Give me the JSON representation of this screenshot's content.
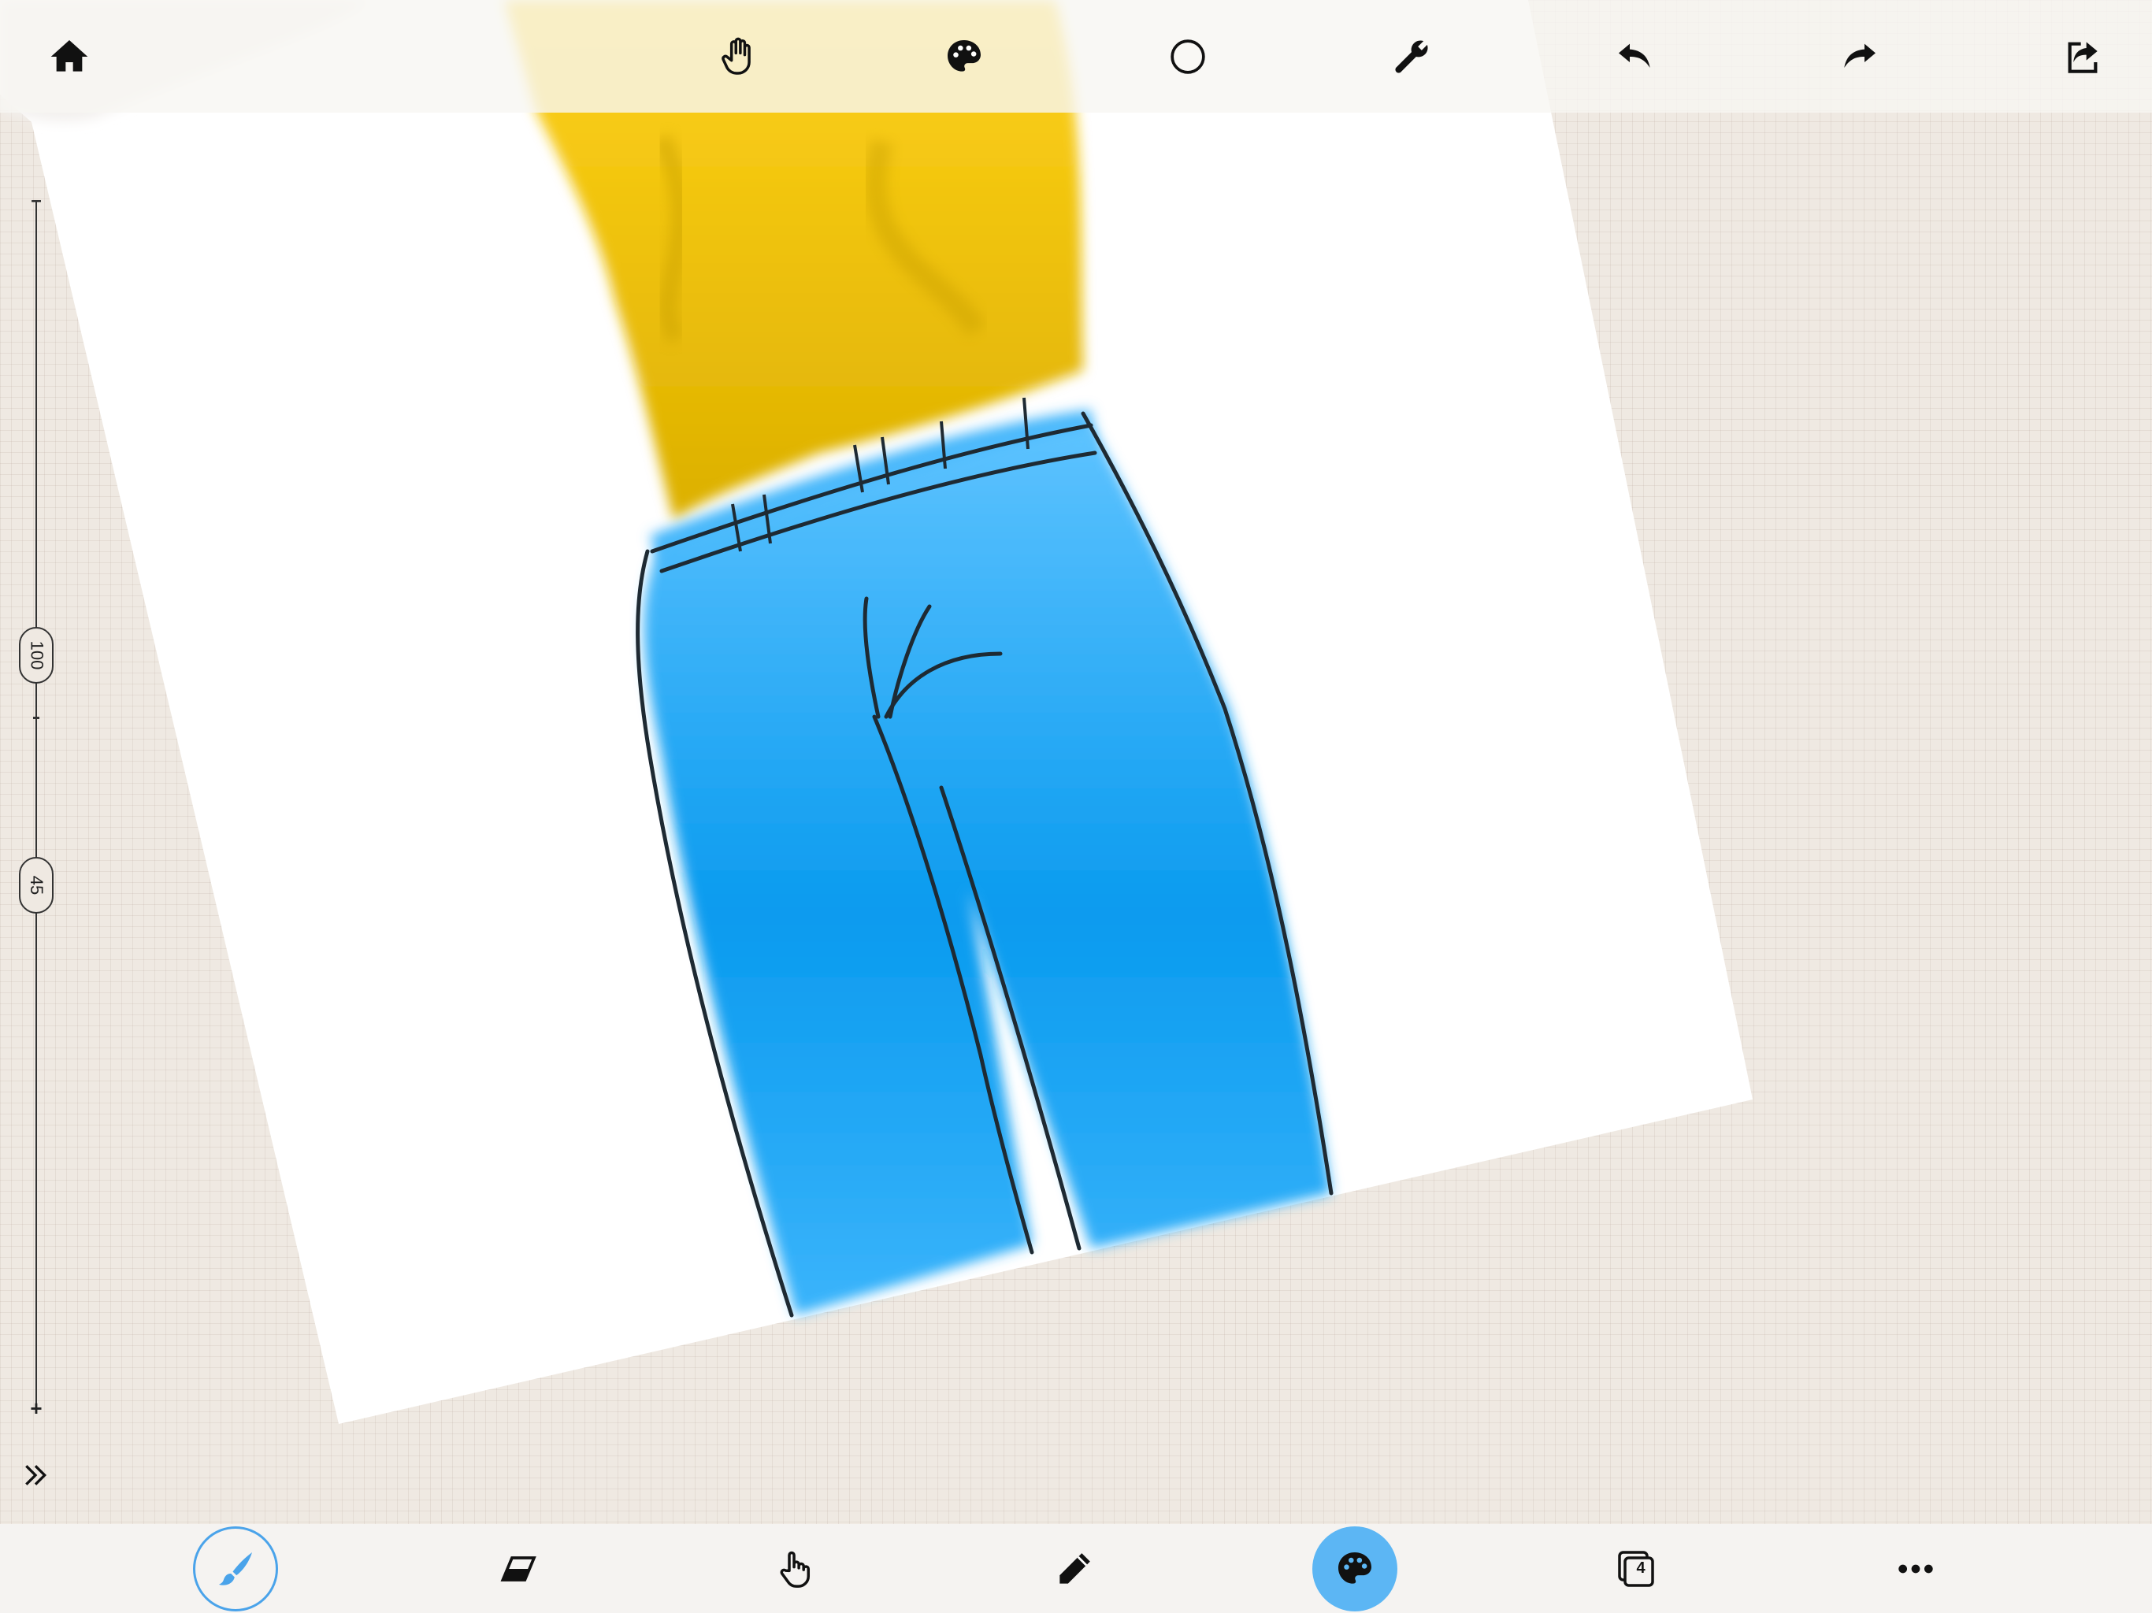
{
  "top_toolbar": {
    "icons": [
      "home-icon",
      "hand-icon",
      "palette-icon",
      "circle-icon",
      "wrench-icon",
      "undo-icon",
      "redo-icon",
      "share-icon"
    ]
  },
  "size_slider": {
    "size_value": "100",
    "opacity_value": "45"
  },
  "bottom_toolbar": {
    "layers_count": "4",
    "icons": [
      "brush-icon",
      "eraser-icon",
      "finger-icon",
      "pencil-icon",
      "palette-icon",
      "layers-icon",
      "more-icon"
    ]
  },
  "colors": {
    "accent": "#4aa3ea",
    "accent_fill": "#5cb6f4",
    "shirt": "#e6bb05",
    "jeans": "#1aa6f2"
  }
}
